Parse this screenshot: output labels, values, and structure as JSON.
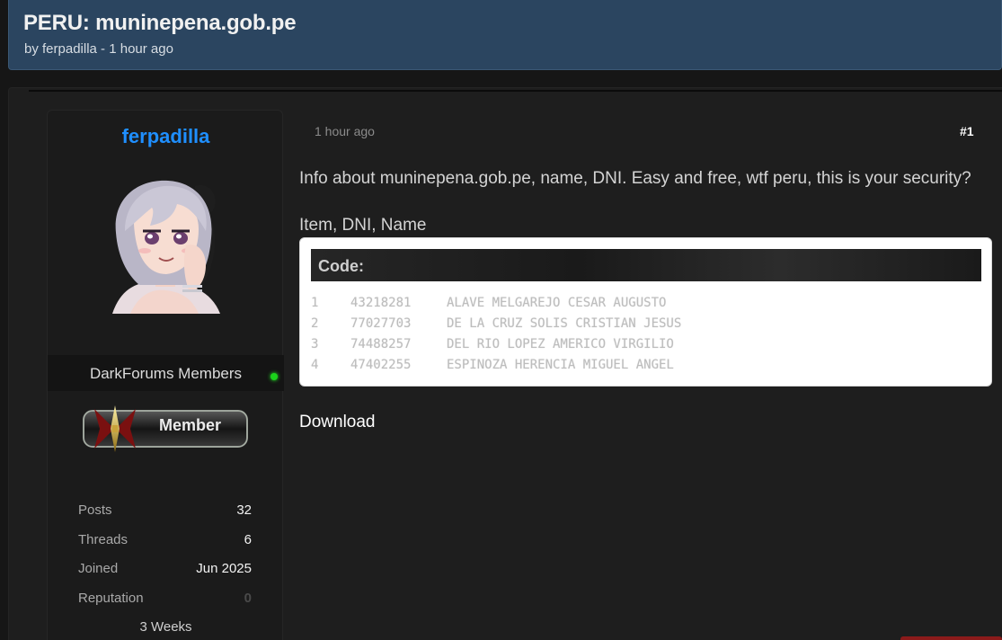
{
  "thread": {
    "title": "PERU: muninepena.gob.pe",
    "meta": "by ferpadilla - 1 hour ago"
  },
  "author": {
    "username": "ferpadilla",
    "group": "DarkForums Members",
    "rank": "Member",
    "online": true,
    "stats": [
      {
        "label": "Posts",
        "value": "32"
      },
      {
        "label": "Threads",
        "value": "6"
      },
      {
        "label": "Joined",
        "value": "Jun 2025"
      },
      {
        "label": "Reputation",
        "value": "0"
      }
    ],
    "time_online": "3 Weeks"
  },
  "post": {
    "time": "1 hour ago",
    "number": "#1",
    "text": "Info about muninepena.gob.pe, name, DNI. Easy and free, wtf peru, this is your security?",
    "list_heading": "Item, DNI, Name",
    "code_title": "Code:",
    "code_rows": [
      {
        "item": "1",
        "dni": "43218281",
        "name": "ALAVE MELGAREJO CESAR AUGUSTO"
      },
      {
        "item": "2",
        "dni": "77027703",
        "name": "DE LA CRUZ SOLIS CRISTIAN JESUS"
      },
      {
        "item": "3",
        "dni": "74488257",
        "name": "DEL RIO LOPEZ AMERICO VIRGILIO"
      },
      {
        "item": "4",
        "dni": "47402255",
        "name": "ESPINOZA HERENCIA MIGUEL ANGEL"
      }
    ],
    "download_label": "Download"
  },
  "colors": {
    "header_bg": "#2b4560",
    "username": "#1f8fff",
    "online": "#1bd31b"
  },
  "icons": [
    "avatar-image",
    "online-status-icon",
    "member-rank-badge"
  ]
}
